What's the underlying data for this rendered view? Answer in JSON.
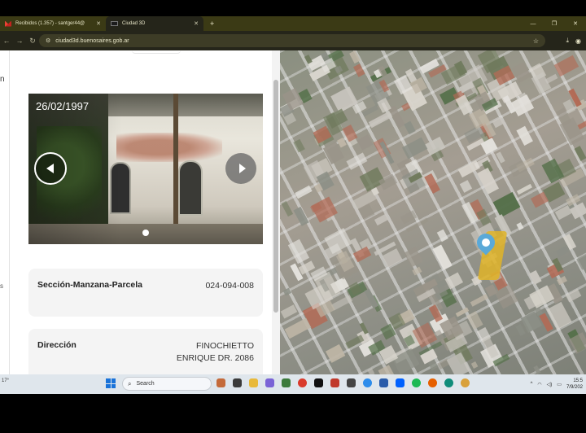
{
  "browser": {
    "tabs": [
      {
        "label": "Recibidos (1.357) - santger44@",
        "icon": "gmail-icon",
        "active": false
      },
      {
        "label": "Ciudad 3D",
        "icon": "ciudad3d-icon",
        "active": true
      }
    ],
    "new_tab": "+",
    "url": "ciudad3d.buenosaires.gob.ar"
  },
  "sidebar": {
    "edge_letter_top": "n",
    "edge_letter_bottom": "s"
  },
  "panel": {
    "photo": {
      "date": "26/02/1997",
      "slide_index": 1,
      "slide_count": 1
    },
    "cards": [
      {
        "label": "Sección-Manzana-Parcela",
        "value": "024-094-008"
      },
      {
        "label": "Dirección",
        "value_line1": "FINOCHIETTO",
        "value_line2": "ENRIQUE DR. 2086"
      }
    ]
  },
  "taskbar": {
    "weather_temp": "17°",
    "search_placeholder": "Search",
    "clock_time": "15:5",
    "clock_date": "7/9/202"
  },
  "colors": {
    "browser_chrome": "#3b3a15",
    "map_pin": "#5aa9d8",
    "parcel_highlight": "#e1b428",
    "card_bg": "#f4f4f4"
  }
}
